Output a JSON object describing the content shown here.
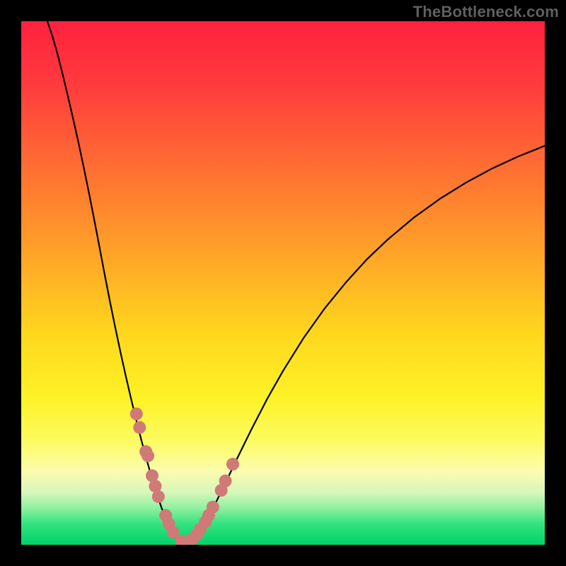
{
  "watermark": "TheBottleneck.com",
  "chart_data": {
    "type": "line",
    "title": "",
    "xlabel": "",
    "ylabel": "",
    "xlim": [
      0,
      100
    ],
    "ylim": [
      0,
      100
    ],
    "grid": false,
    "legend": false,
    "gradient_stops": [
      {
        "offset": 0.0,
        "color": "#ff213f"
      },
      {
        "offset": 0.12,
        "color": "#ff3b3d"
      },
      {
        "offset": 0.28,
        "color": "#ff6e33"
      },
      {
        "offset": 0.44,
        "color": "#ffa228"
      },
      {
        "offset": 0.6,
        "color": "#ffd81e"
      },
      {
        "offset": 0.72,
        "color": "#fdf226"
      },
      {
        "offset": 0.8,
        "color": "#fcfb60"
      },
      {
        "offset": 0.86,
        "color": "#fbfcb0"
      },
      {
        "offset": 0.9,
        "color": "#d6f7ba"
      },
      {
        "offset": 0.93,
        "color": "#8ef0a0"
      },
      {
        "offset": 0.96,
        "color": "#33e37f"
      },
      {
        "offset": 1.0,
        "color": "#00d36a"
      }
    ],
    "series": [
      {
        "name": "bottleneck-curve",
        "x": [
          5.0,
          6.0,
          7.0,
          8.0,
          9.0,
          10.0,
          11.0,
          12.0,
          13.0,
          14.0,
          15.0,
          16.0,
          17.0,
          18.0,
          19.0,
          20.0,
          21.0,
          22.0,
          23.0,
          24.0,
          25.0,
          26.0,
          27.0,
          28.0,
          29.0,
          30.0,
          31.0,
          32.0,
          33.5,
          35.0,
          37.0,
          39.0,
          41.0,
          44.0,
          47.0,
          50.0,
          54.0,
          58.0,
          62.0,
          66.0,
          70.0,
          75.0,
          80.0,
          85.0,
          90.0,
          95.0,
          100.0
        ],
        "y": [
          100.0,
          97.0,
          93.5,
          89.5,
          85.3,
          81.0,
          76.5,
          71.8,
          66.9,
          61.8,
          56.6,
          51.3,
          46.2,
          41.3,
          36.6,
          32.1,
          27.8,
          23.7,
          19.8,
          16.1,
          12.6,
          9.4,
          6.5,
          4.1,
          2.2,
          0.9,
          0.4,
          0.7,
          1.7,
          3.9,
          7.7,
          11.8,
          16.0,
          22.1,
          27.9,
          33.2,
          39.6,
          45.2,
          50.1,
          54.5,
          58.3,
          62.5,
          66.1,
          69.2,
          71.9,
          74.2,
          76.2
        ]
      }
    ],
    "markers": {
      "name": "sample-points",
      "color": "#cf7a76",
      "x": [
        22.0,
        22.6,
        23.8,
        24.2,
        25.0,
        25.6,
        26.2,
        27.6,
        28.2,
        29.0,
        30.6,
        31.2,
        32.8,
        33.6,
        34.2,
        35.2,
        35.8,
        36.6,
        38.2,
        39.0,
        40.4
      ],
      "y": [
        25.0,
        22.4,
        17.8,
        17.0,
        13.2,
        11.2,
        9.2,
        5.6,
        4.0,
        2.4,
        0.7,
        0.6,
        1.2,
        2.0,
        3.0,
        4.4,
        5.6,
        7.2,
        10.4,
        12.2,
        15.4
      ]
    }
  }
}
